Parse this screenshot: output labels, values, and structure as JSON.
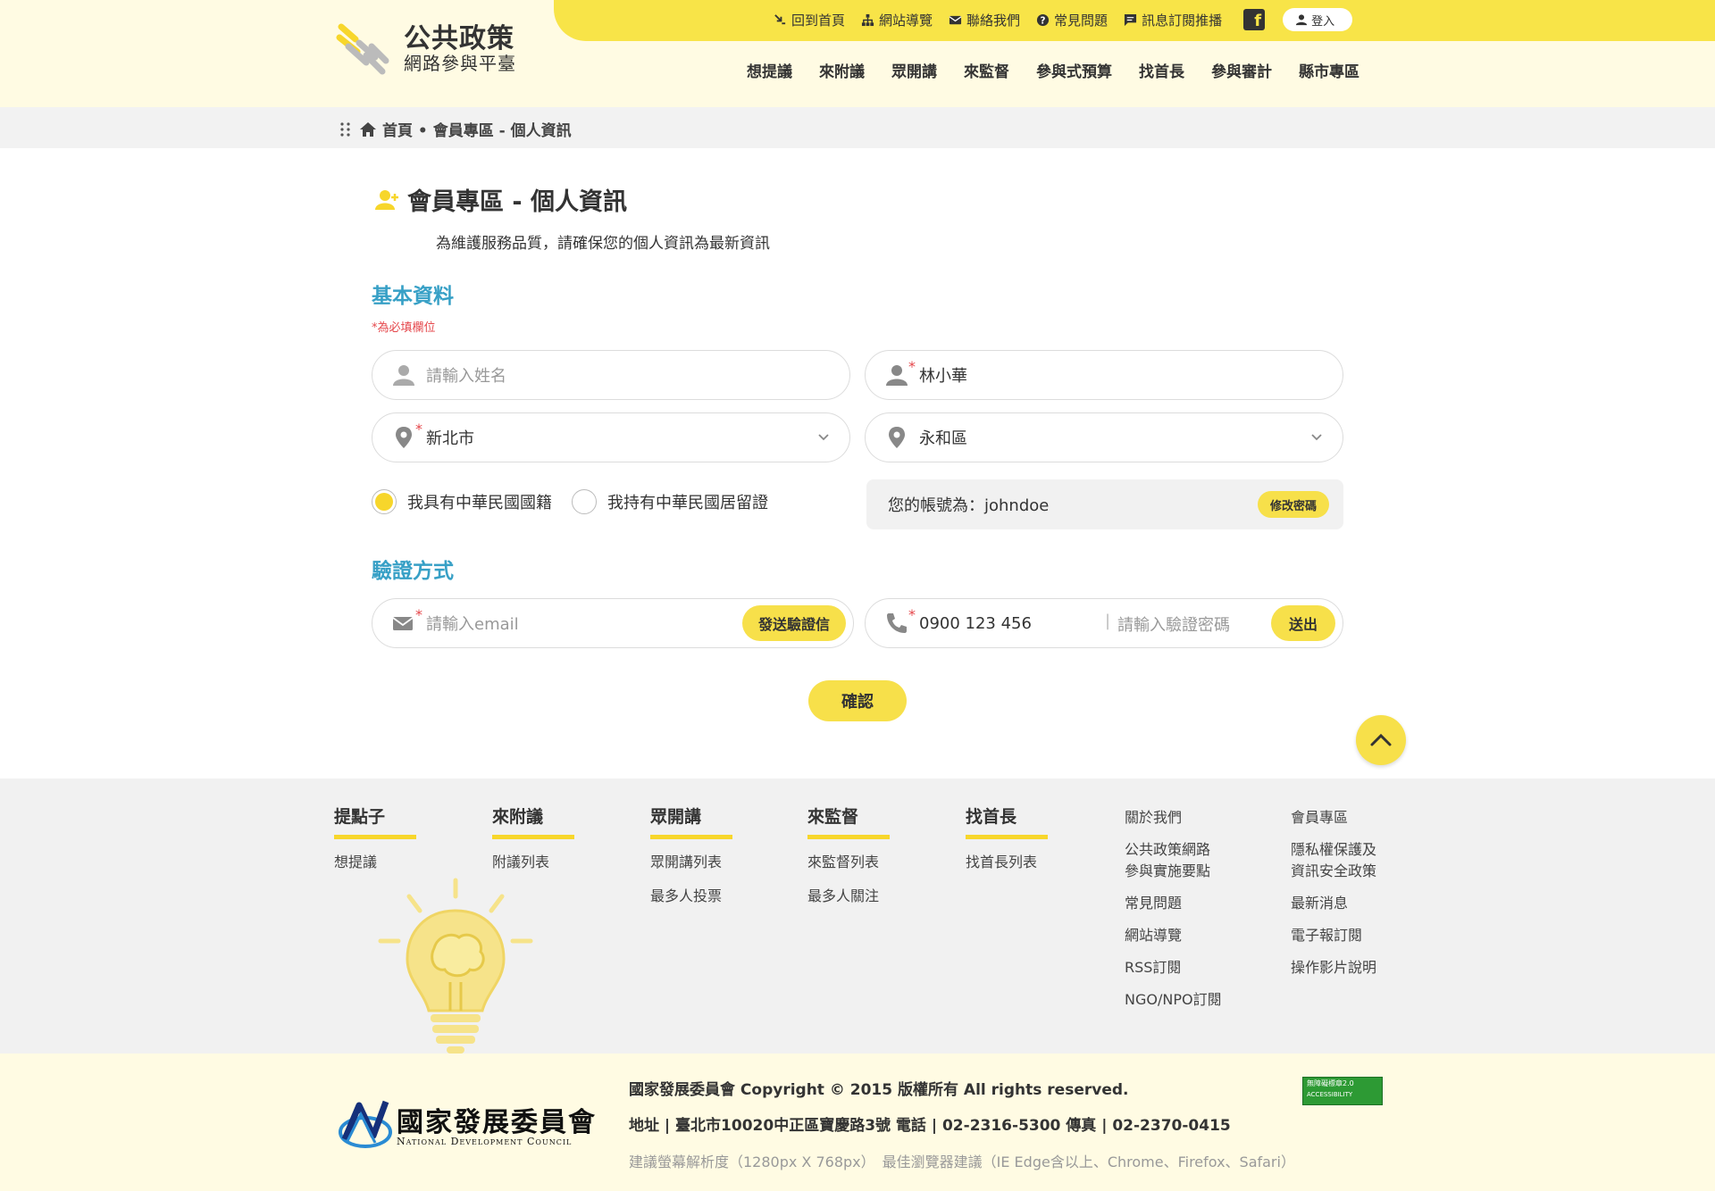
{
  "header": {
    "logo_title": "公共政策",
    "logo_sub": "網路參與平臺",
    "util_links": [
      {
        "label": "回到首頁",
        "icon": "home-arrow-icon"
      },
      {
        "label": "網站導覽",
        "icon": "sitemap-icon"
      },
      {
        "label": "聯絡我們",
        "icon": "mail-icon"
      },
      {
        "label": "常見問題",
        "icon": "question-icon"
      },
      {
        "label": "訊息訂閱推播",
        "icon": "chat-icon"
      }
    ],
    "login": "登入",
    "nav": [
      "想提議",
      "來附議",
      "眾開講",
      "來監督",
      "參與式預算",
      "找首長",
      "參與審計",
      "縣市專區"
    ]
  },
  "breadcrumb": "首頁 • 會員專區 - 個人資訊",
  "page": {
    "title": "會員專區 - 個人資訊",
    "desc": "為維護服務品質，請確保您的個人資訊為最新資訊"
  },
  "basic": {
    "section_title": "基本資料",
    "required_note": "*為必填欄位",
    "name_placeholder": "請輸入姓名",
    "nickname_value": "林小華",
    "city_value": "新北市",
    "district_value": "永和區",
    "radio_citizen": "我具有中華民國國籍",
    "radio_resident": "我持有中華民國居留證",
    "account_label": "您的帳號為：johndoe",
    "change_password": "修改密碼"
  },
  "verify": {
    "section_title": "驗證方式",
    "email_placeholder": "請輸入email",
    "send_email_btn": "發送驗證信",
    "phone_value": "0900 123 456",
    "code_placeholder": "請輸入驗證密碼",
    "send_btn": "送出"
  },
  "confirm": "確認",
  "footer": {
    "columns": [
      {
        "head": "提點子",
        "items": [
          "想提議"
        ]
      },
      {
        "head": "來附議",
        "items": [
          "附議列表"
        ]
      },
      {
        "head": "眾開講",
        "items": [
          "眾開講列表",
          "最多人投票"
        ]
      },
      {
        "head": "來監督",
        "items": [
          "來監督列表",
          "最多人關注"
        ]
      },
      {
        "head": "找首長",
        "items": [
          "找首長列表"
        ]
      }
    ],
    "links_a": [
      "關於我們",
      "公共政策網路",
      "參與實施要點",
      "常見問題",
      "網站導覽",
      "RSS訂閱",
      "NGO/NPO訂閱"
    ],
    "links_b": [
      "會員專區",
      "隱私權保護及",
      "資訊安全政策",
      "最新消息",
      "電子報訂閱",
      "操作影片說明"
    ]
  },
  "bottom": {
    "org_cn": "國家發展委員會",
    "org_en": "National Development Council",
    "copyright": "國家發展委員會 Copyright © 2015 版權所有 All rights reserved.",
    "address": "地址 | 臺北市10020中正區寶慶路3號 電話 | 02-2316-5300 傳真 | 02-2370-0415",
    "hint": "建議螢幕解析度（1280px X 768px）　最佳瀏覽器建議（IE Edge含以上、Chrome、Firefox、Safari）",
    "badge_line1": "無障礙標章2.0",
    "badge_line2": "ACCESSIBILITY"
  },
  "colors": {
    "accent": "#f7e04a",
    "header_bg": "#fffbe3",
    "section_blue": "#37a0c6",
    "required_red": "#e5474b"
  }
}
